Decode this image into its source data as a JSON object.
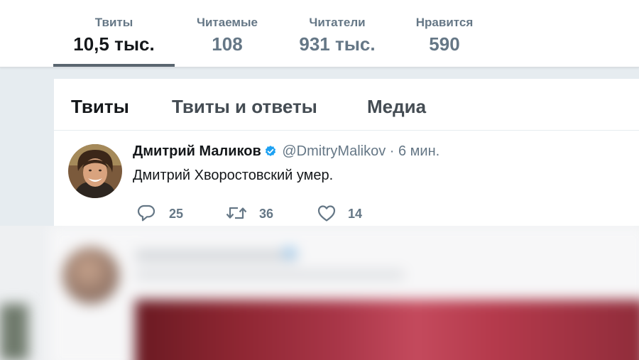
{
  "stats": [
    {
      "label": "Твиты",
      "value": "10,5 тыс."
    },
    {
      "label": "Читаемые",
      "value": "108"
    },
    {
      "label": "Читатели",
      "value": "931 тыс."
    },
    {
      "label": "Нравится",
      "value": "590"
    }
  ],
  "tabs": [
    {
      "label": "Твиты"
    },
    {
      "label": "Твиты и ответы"
    },
    {
      "label": "Медиа"
    }
  ],
  "tweet": {
    "author_name": "Дмитрий Маликов",
    "handle": "@DmitryMalikov",
    "separator": "·",
    "time": "6 мин.",
    "text": "Дмитрий Хворостовский умер.",
    "replies": "25",
    "retweets": "36",
    "likes": "14",
    "verified": true
  },
  "colors": {
    "accent": "#1da1f2",
    "text_primary": "#14171a",
    "text_secondary": "#657786",
    "active_underline": "#5a6670"
  },
  "icons": [
    "verified-badge-icon",
    "reply-icon",
    "retweet-icon",
    "like-icon"
  ]
}
